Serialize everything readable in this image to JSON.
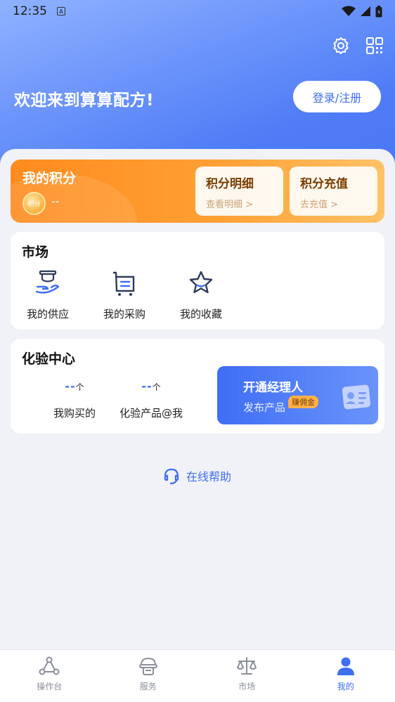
{
  "status": {
    "time": "12:35",
    "indicator": "A"
  },
  "header": {
    "welcome": "欢迎来到算算配方!",
    "login_label": "登录/注册",
    "icons": [
      "gear-icon",
      "qr-code-icon"
    ]
  },
  "points": {
    "title": "我的积分",
    "coin_label": "积分",
    "value": "--",
    "detail": {
      "title": "积分明细",
      "sub": "查看明细 >"
    },
    "recharge": {
      "title": "积分充值",
      "sub": "去充值 >"
    }
  },
  "market": {
    "title": "市场",
    "items": [
      {
        "label": "我的供应",
        "icon": "supply-hand-icon"
      },
      {
        "label": "我的采购",
        "icon": "cart-icon"
      },
      {
        "label": "我的收藏",
        "icon": "star-icon"
      }
    ]
  },
  "lab": {
    "title": "化验中心",
    "stats": [
      {
        "value": "--",
        "unit": "个",
        "label": "我购买的"
      },
      {
        "value": "--",
        "unit": "个",
        "label": "化验产品@我"
      }
    ],
    "agent": {
      "title": "开通经理人",
      "subtitle": "发布产品",
      "badge": "赚佣金"
    }
  },
  "help": {
    "label": "在线帮助"
  },
  "tabs": [
    {
      "label": "操作台",
      "icon": "workbench-icon",
      "active": false
    },
    {
      "label": "服务",
      "icon": "service-icon",
      "active": false
    },
    {
      "label": "市场",
      "icon": "scale-icon",
      "active": false
    },
    {
      "label": "我的",
      "icon": "user-icon",
      "active": true
    }
  ],
  "colors": {
    "primary": "#3e6ef2",
    "orange": "#ff8b1f",
    "background": "#f1f2f7"
  }
}
